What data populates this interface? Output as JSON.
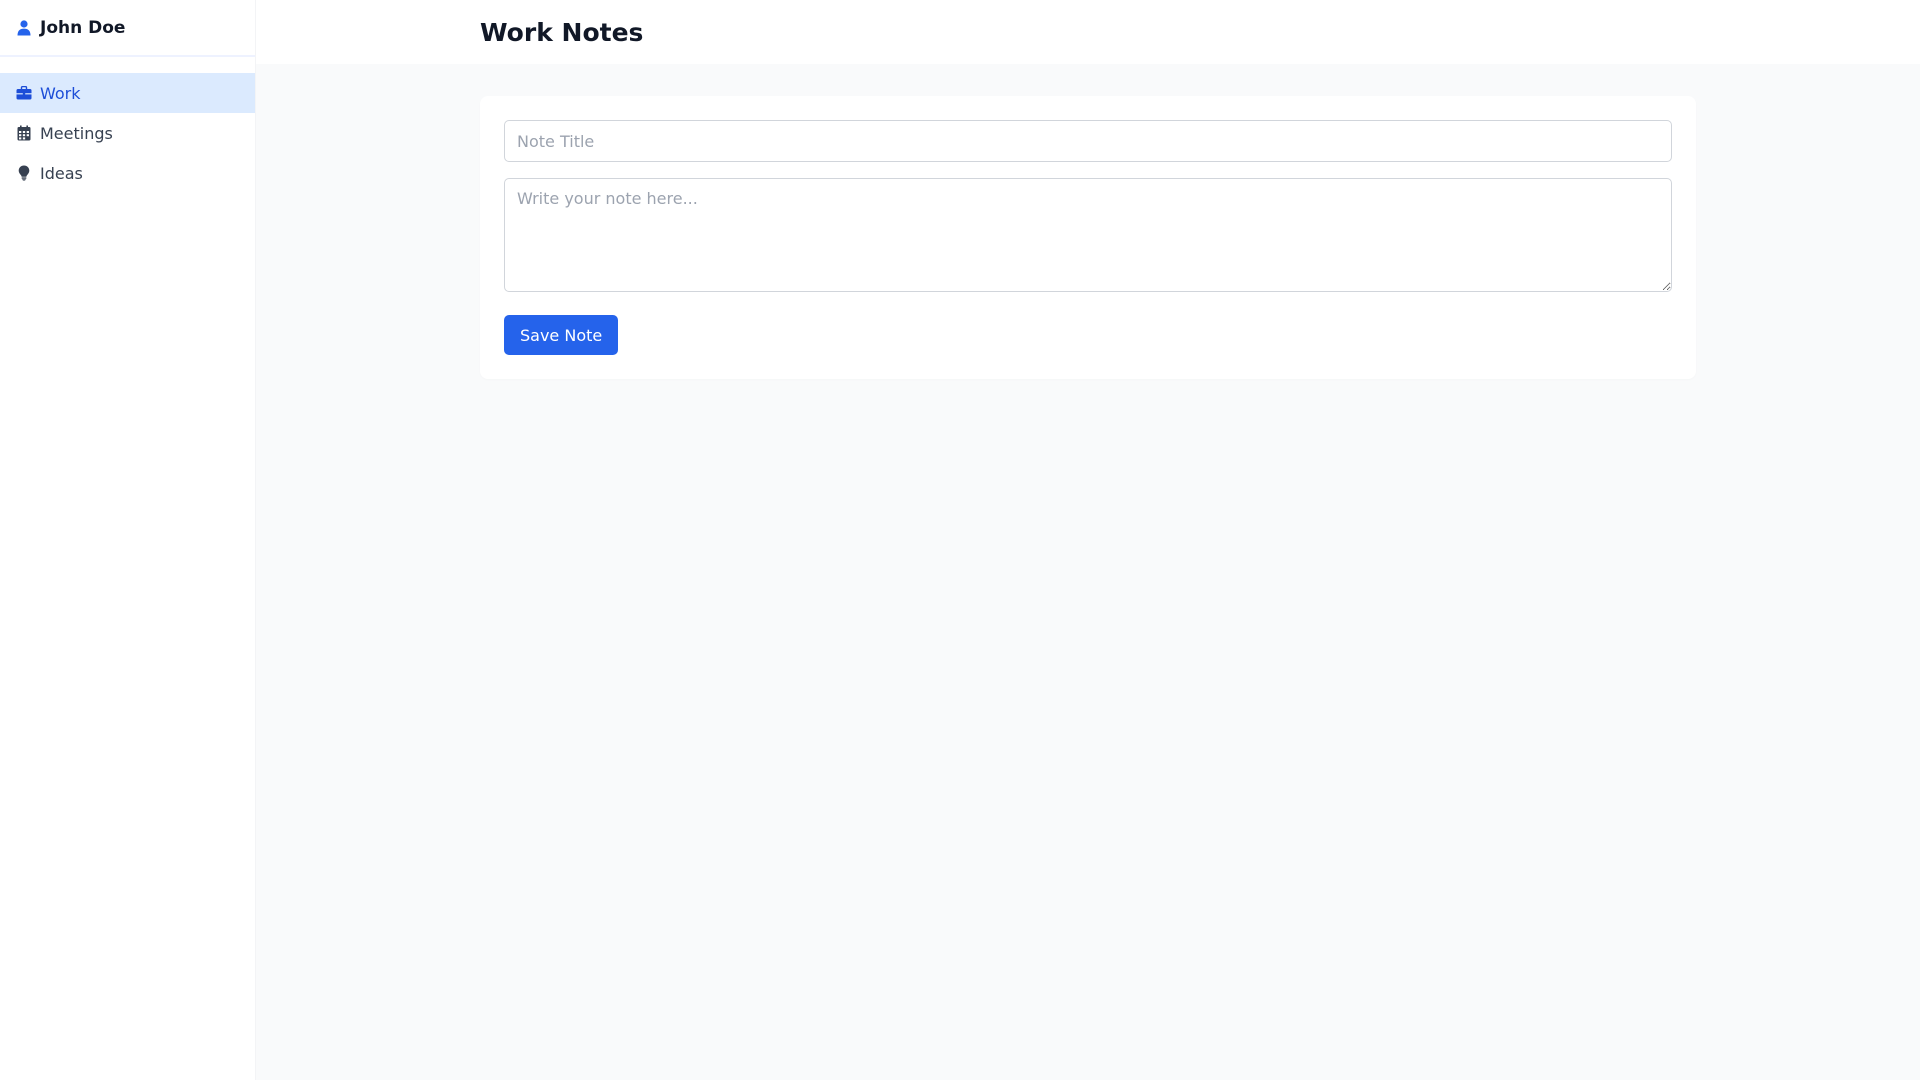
{
  "sidebar": {
    "user": {
      "name": "John Doe",
      "icon": "user-icon"
    },
    "items": [
      {
        "label": "Work",
        "icon": "briefcase-icon",
        "active": true
      },
      {
        "label": "Meetings",
        "icon": "calendar-icon",
        "active": false
      },
      {
        "label": "Ideas",
        "icon": "lightbulb-icon",
        "active": false
      }
    ]
  },
  "header": {
    "title": "Work Notes"
  },
  "editor": {
    "title_placeholder": "Note Title",
    "title_value": "",
    "body_placeholder": "Write your note here...",
    "body_value": "",
    "save_label": "Save Note"
  },
  "colors": {
    "accent": "#2563eb",
    "active_bg": "#dbeafe",
    "active_text": "#1d4ed8",
    "page_bg": "#f9fafb"
  }
}
